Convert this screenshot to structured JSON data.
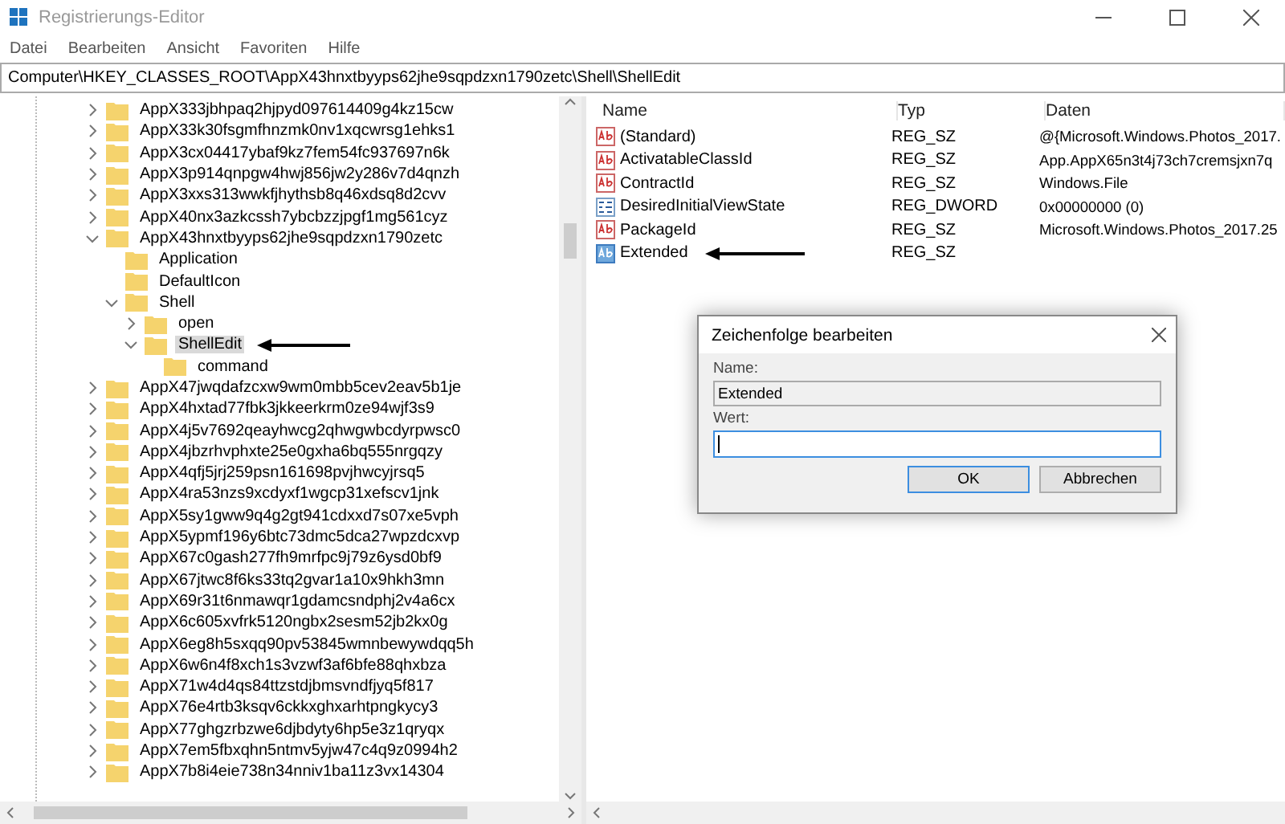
{
  "window": {
    "title": "Registrierungs-Editor"
  },
  "menu": [
    "Datei",
    "Bearbeiten",
    "Ansicht",
    "Favoriten",
    "Hilfe"
  ],
  "address": "Computer\\HKEY_CLASSES_ROOT\\AppX43hnxtbyyps62jhe9sqpdzxn1790zetc\\Shell\\ShellEdit",
  "tree": [
    {
      "label": "AppX333jbhpaq2hjpyd097614409g4kz15cw",
      "expanded": false,
      "selected": false,
      "marked": false
    },
    {
      "label": "AppX33k30fsgmfhnzmk0nv1xqcwrsg1ehks1",
      "expanded": false,
      "selected": false,
      "marked": false
    },
    {
      "label": "AppX3cx04417ybaf9kz7fem54fc937697n6k",
      "expanded": false,
      "selected": false,
      "marked": false
    },
    {
      "label": "AppX3p914qnpgw4hwj856jw2y286v7d4qnzh",
      "expanded": false,
      "selected": false,
      "marked": false
    },
    {
      "label": "AppX3xxs313wwkfjhythsb8q46xdsq8d2cvv",
      "expanded": false,
      "selected": false,
      "marked": false
    },
    {
      "label": "AppX40nx3azkcssh7ybcbzzjpgf1mg561cyz",
      "expanded": false,
      "selected": false,
      "marked": false
    },
    {
      "label": "AppX43hnxtbyyps62jhe9sqpdzxn1790zetc",
      "expanded": true,
      "selected": false,
      "marked": false,
      "children": [
        {
          "label": "Application",
          "selected": false,
          "marked": false
        },
        {
          "label": "DefaultIcon",
          "selected": false,
          "marked": false
        },
        {
          "label": "Shell",
          "expanded": true,
          "selected": false,
          "marked": false,
          "children": [
            {
              "label": "open",
              "expanded": false,
              "selected": false,
              "marked": false
            },
            {
              "label": "ShellEdit",
              "expanded": true,
              "selected": true,
              "marked": true,
              "children": [
                {
                  "label": "command",
                  "selected": false,
                  "marked": false
                }
              ]
            }
          ]
        }
      ]
    },
    {
      "label": "AppX47jwqdafzcxw9wm0mbb5cev2eav5b1je",
      "expanded": false,
      "selected": false,
      "marked": false
    },
    {
      "label": "AppX4hxtad77fbk3jkkeerkrm0ze94wjf3s9",
      "expanded": false,
      "selected": false,
      "marked": false
    },
    {
      "label": "AppX4j5v7692qeayhwcg2qhwgwbcdyrpwsc0",
      "expanded": false,
      "selected": false,
      "marked": false
    },
    {
      "label": "AppX4jbzrhvphxte25e0gxha6bq555nrgqzy",
      "expanded": false,
      "selected": false,
      "marked": false
    },
    {
      "label": "AppX4qfj5jrj259psn161698pvjhwcyjrsq5",
      "expanded": false,
      "selected": false,
      "marked": false
    },
    {
      "label": "AppX4ra53nzs9xcdyxf1wgcp31xefscv1jnk",
      "expanded": false,
      "selected": false,
      "marked": false
    },
    {
      "label": "AppX5sy1gww9q4g2gt941cdxxd7s07xe5vph",
      "expanded": false,
      "selected": false,
      "marked": false
    },
    {
      "label": "AppX5ypmf196y6btc73dmc5dca27wpzdcxvp",
      "expanded": false,
      "selected": false,
      "marked": false
    },
    {
      "label": "AppX67c0gash277fh9mrfpc9j79z6ysd0bf9",
      "expanded": false,
      "selected": false,
      "marked": false
    },
    {
      "label": "AppX67jtwc8f6ks33tq2gvar1a10x9hkh3mn",
      "expanded": false,
      "selected": false,
      "marked": false
    },
    {
      "label": "AppX69r31t6nmawqr1gdamcsndphj2v4a6cx",
      "expanded": false,
      "selected": false,
      "marked": false
    },
    {
      "label": "AppX6c605xvfrk5120ngbx2sesm52jb2kx0g",
      "expanded": false,
      "selected": false,
      "marked": false
    },
    {
      "label": "AppX6eg8h5sxqq90pv53845wmnbewywdqq5h",
      "expanded": false,
      "selected": false,
      "marked": false
    },
    {
      "label": "AppX6w6n4f8xch1s3vzwf3af6bfe88qhxbza",
      "expanded": false,
      "selected": false,
      "marked": false
    },
    {
      "label": "AppX71w4d4qs84ttzstdjbmsvndfjyq5f817",
      "expanded": false,
      "selected": false,
      "marked": false
    },
    {
      "label": "AppX76e4rtb3ksqv6ckkxghxarhtpngkycy3",
      "expanded": false,
      "selected": false,
      "marked": false
    },
    {
      "label": "AppX77ghgzrbzwe6djbdyty6hp5e3z1qryqx",
      "expanded": false,
      "selected": false,
      "marked": false
    },
    {
      "label": "AppX7em5fbxqhn5ntmv5yjw47c4q9z0994h2",
      "expanded": false,
      "selected": false,
      "marked": false
    },
    {
      "label": "AppX7b8i4eie738n34nniv1ba11z3vx14304",
      "expanded": false,
      "selected": false,
      "marked": false
    }
  ],
  "values": {
    "columns": [
      "Name",
      "Typ",
      "Daten"
    ],
    "rows": [
      {
        "kind": "string",
        "name": "(Standard)",
        "type": "REG_SZ",
        "data": "@{Microsoft.Windows.Photos_2017.",
        "selected": false,
        "marked": false
      },
      {
        "kind": "string",
        "name": "ActivatableClassId",
        "type": "REG_SZ",
        "data": "App.AppX65n3t4j73ch7cremsjxn7q",
        "selected": false,
        "marked": false
      },
      {
        "kind": "string",
        "name": "ContractId",
        "type": "REG_SZ",
        "data": "Windows.File",
        "selected": false,
        "marked": false
      },
      {
        "kind": "binary",
        "name": "DesiredInitialViewState",
        "type": "REG_DWORD",
        "data": "0x00000000 (0)",
        "selected": false,
        "marked": false
      },
      {
        "kind": "string",
        "name": "PackageId",
        "type": "REG_SZ",
        "data": "Microsoft.Windows.Photos_2017.25",
        "selected": false,
        "marked": false
      },
      {
        "kind": "string",
        "name": "Extended",
        "type": "REG_SZ",
        "selected": true,
        "marked": true
      }
    ]
  },
  "dialog": {
    "title": "Zeichenfolge bearbeiten",
    "name_label": "Name:",
    "name_value": "Extended",
    "value_label": "Wert:",
    "buttons": [
      "OK",
      "Abbrechen"
    ]
  }
}
